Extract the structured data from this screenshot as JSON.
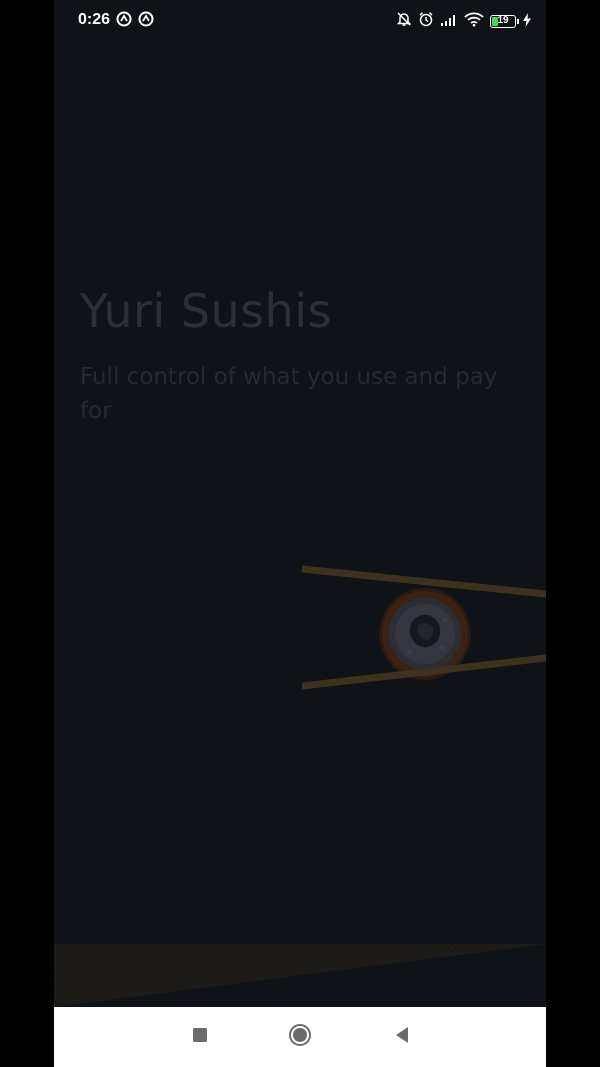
{
  "status_bar": {
    "time": "0:26",
    "battery_level": "19",
    "left_icons": [
      "notification-app-icon",
      "notification-app-icon"
    ],
    "right_icons": [
      "bell-off-icon",
      "alarm-icon",
      "signal-icon",
      "wifi-icon",
      "battery-icon",
      "charging-icon"
    ]
  },
  "hero": {
    "title": "Yuri Sushis",
    "subtitle": "Full control of what you use and pay for"
  },
  "nav_bar": {
    "buttons": [
      "recent-apps-icon",
      "home-icon",
      "back-icon"
    ]
  },
  "colors": {
    "background": "#0f1217",
    "title_text": "#2c2f36",
    "subtitle_text": "#262930",
    "nav_background": "#ffffff",
    "nav_icon": "#6b6b6b"
  }
}
